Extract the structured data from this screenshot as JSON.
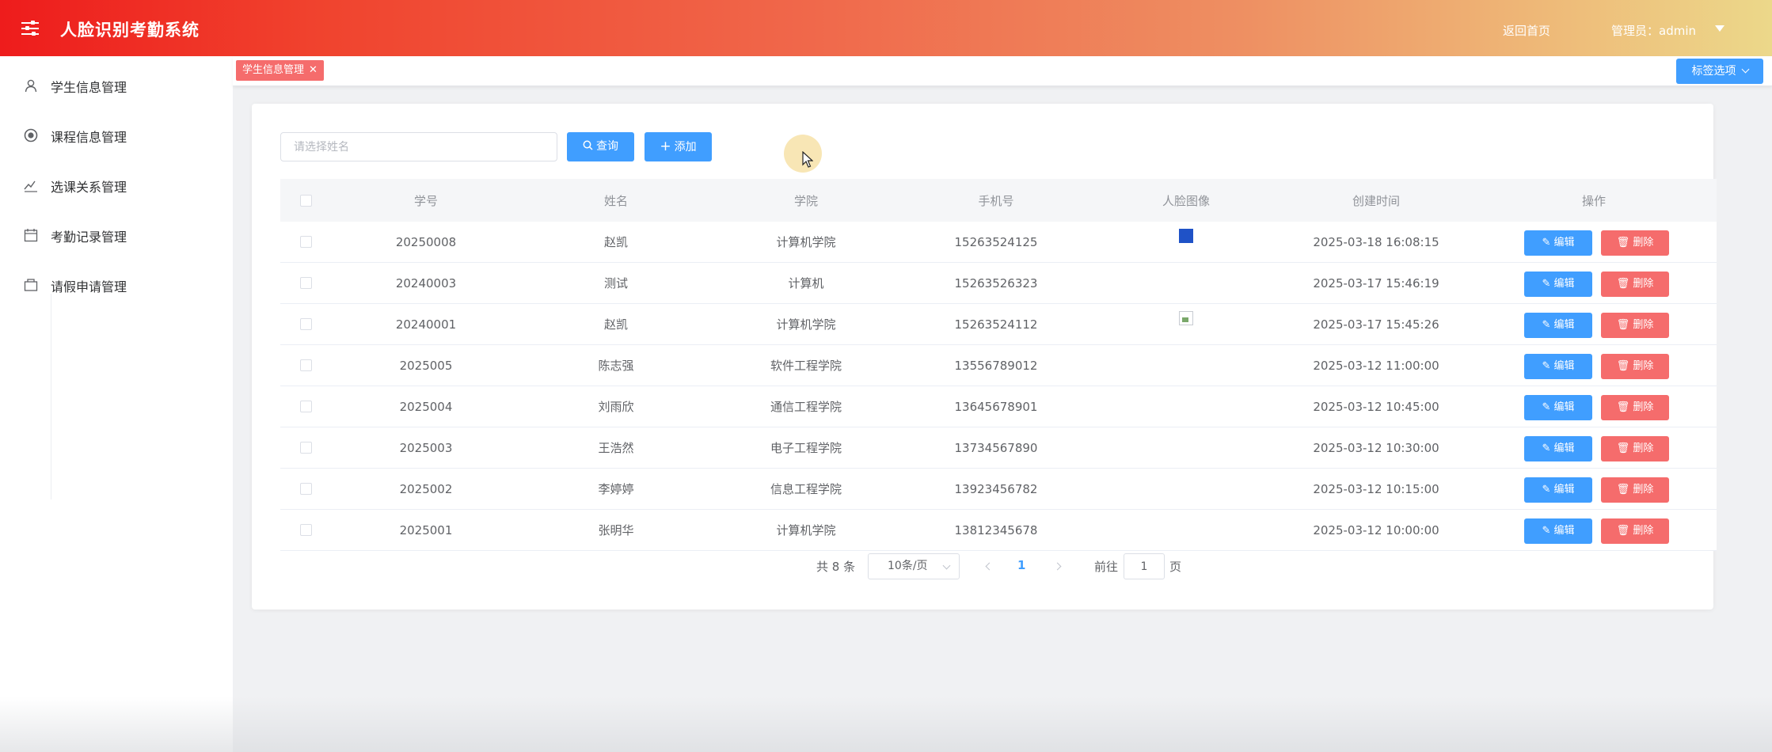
{
  "header": {
    "app_title": "人脸识别考勤系统",
    "home_link": "返回首页",
    "user_label": "管理员：admin"
  },
  "sidebar": {
    "items": [
      {
        "label": "学生信息管理",
        "icon": "user-icon"
      },
      {
        "label": "课程信息管理",
        "icon": "course-icon"
      },
      {
        "label": "选课关系管理",
        "icon": "relation-icon"
      },
      {
        "label": "考勤记录管理",
        "icon": "calendar-icon"
      },
      {
        "label": "请假申请管理",
        "icon": "leave-icon"
      }
    ]
  },
  "tags": {
    "active_tag": "学生信息管理",
    "options_label": "标签选项"
  },
  "toolbar": {
    "search_placeholder": "请选择姓名",
    "query_label": "查询",
    "add_label": "添加"
  },
  "table": {
    "headers": {
      "student_no": "学号",
      "name": "姓名",
      "college": "学院",
      "phone": "手机号",
      "face": "人脸图像",
      "created": "创建时间",
      "ops": "操作"
    },
    "edit_label": "编辑",
    "delete_label": "删除",
    "rows": [
      {
        "student_no": "20250008",
        "name": "赵凯",
        "college": "计算机学院",
        "phone": "15263524125",
        "face": "image",
        "created": "2025-03-18 16:08:15"
      },
      {
        "student_no": "20240003",
        "name": "测试",
        "college": "计算机",
        "phone": "15263526323",
        "face": "none",
        "created": "2025-03-17 15:46:19"
      },
      {
        "student_no": "20240001",
        "name": "赵凯",
        "college": "计算机学院",
        "phone": "15263524112",
        "face": "broken",
        "created": "2025-03-17 15:45:26"
      },
      {
        "student_no": "2025005",
        "name": "陈志强",
        "college": "软件工程学院",
        "phone": "13556789012",
        "face": "none",
        "created": "2025-03-12 11:00:00"
      },
      {
        "student_no": "2025004",
        "name": "刘雨欣",
        "college": "通信工程学院",
        "phone": "13645678901",
        "face": "none",
        "created": "2025-03-12 10:45:00"
      },
      {
        "student_no": "2025003",
        "name": "王浩然",
        "college": "电子工程学院",
        "phone": "13734567890",
        "face": "none",
        "created": "2025-03-12 10:30:00"
      },
      {
        "student_no": "2025002",
        "name": "李婷婷",
        "college": "信息工程学院",
        "phone": "13923456782",
        "face": "none",
        "created": "2025-03-12 10:15:00"
      },
      {
        "student_no": "2025001",
        "name": "张明华",
        "college": "计算机学院",
        "phone": "13812345678",
        "face": "none",
        "created": "2025-03-12 10:00:00"
      }
    ]
  },
  "pagination": {
    "total_text": "共 8 条",
    "page_size": "10条/页",
    "current_page": "1",
    "goto_label": "前往",
    "goto_value": "1",
    "page_unit": "页"
  },
  "colors": {
    "primary": "#409eff",
    "danger": "#f56c6c",
    "header_start": "#ee1c1c",
    "header_end": "#ecd88a"
  }
}
